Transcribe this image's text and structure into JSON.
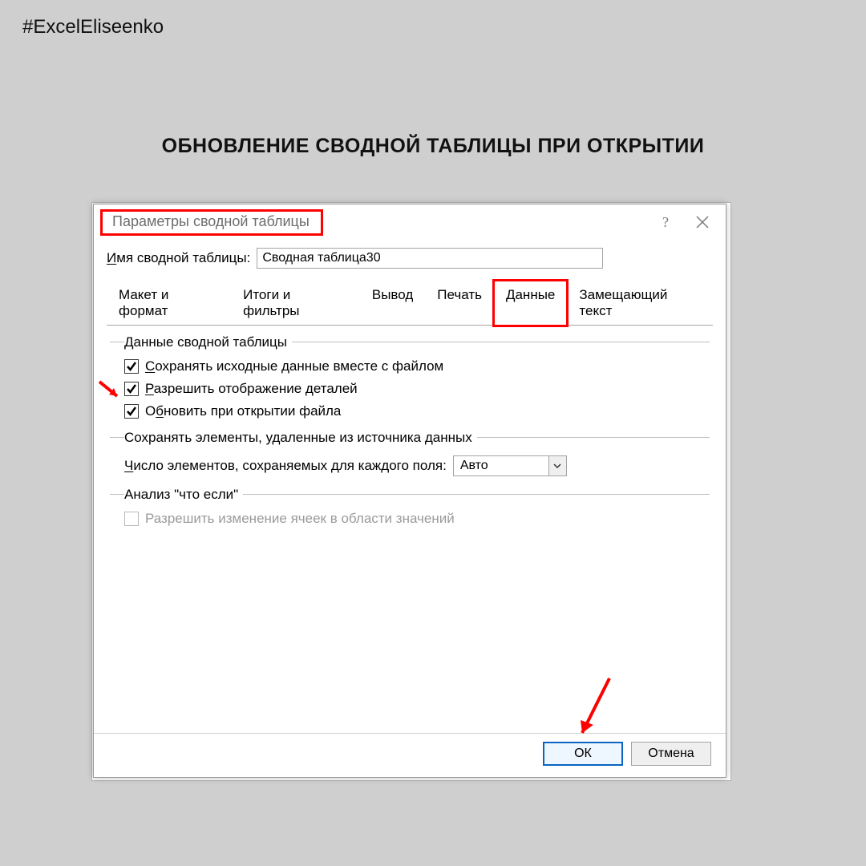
{
  "page": {
    "hashtag": "#ExcelEliseenko",
    "heading": "ОБНОВЛЕНИЕ СВОДНОЙ ТАБЛИЦЫ ПРИ ОТКРЫТИИ"
  },
  "dialog": {
    "title": "Параметры сводной таблицы",
    "help_symbol": "?",
    "name_label_prefix_u": "И",
    "name_label_rest": "мя сводной таблицы:",
    "name_value": "Сводная таблица30",
    "tabs": [
      {
        "label": "Макет и формат"
      },
      {
        "label": "Итоги и фильтры"
      },
      {
        "label": "Вывод"
      },
      {
        "label": "Печать"
      },
      {
        "label": "Данные"
      },
      {
        "label": "Замещающий текст"
      }
    ],
    "section_data_legend": "Данные сводной таблицы",
    "checkboxes": [
      {
        "u": "С",
        "rest": "охранять исходные данные вместе с файлом",
        "checked": true,
        "disabled": false
      },
      {
        "u": "Р",
        "rest": "азрешить отображение деталей",
        "checked": true,
        "disabled": false
      },
      {
        "pre": "О",
        "u": "б",
        "post": "новить при открытии файла",
        "checked": true,
        "disabled": false
      }
    ],
    "section_retain_legend": "Сохранять элементы, удаленные из источника данных",
    "retain_label_u": "Ч",
    "retain_label_rest": "исло элементов, сохраняемых для каждого поля:",
    "retain_select_value": "Авто",
    "section_whatif_legend": "Анализ \"что если\"",
    "whatif_check_label": "Разрешить изменение ячеек в области значений",
    "ok_label": "ОК",
    "cancel_label": "Отмена"
  }
}
